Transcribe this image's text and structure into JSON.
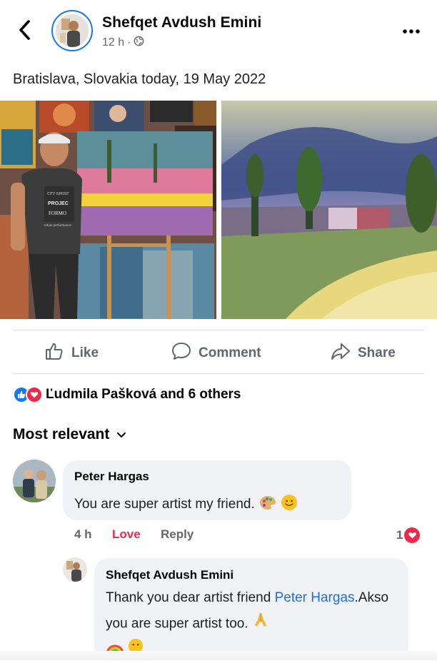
{
  "header": {
    "author": "Shefqet Avdush Emini",
    "time": "12 h",
    "dot": "·",
    "privacy_icon": "globe-icon"
  },
  "post": {
    "caption": "Bratislava, Slovakia today, 19 May 2022",
    "photo_left_shirt_lines": [
      "CITY GHOST",
      "PROJEC",
      "FORMO",
      "urban performance"
    ]
  },
  "actions": {
    "like": "Like",
    "comment": "Comment",
    "share": "Share"
  },
  "reactions": {
    "summary": "Ľudmila Pašková and 6 others",
    "icons": [
      "like-reaction-icon",
      "love-reaction-icon"
    ],
    "like_color": "#1877f2",
    "love_color": "#f02849"
  },
  "comments": {
    "sort_label": "Most relevant",
    "items": [
      {
        "name": "Peter Hargas",
        "text": "You are super artist my friend.",
        "emojis": [
          "palette-emoji",
          "smile-emoji"
        ],
        "time": "4 h",
        "love_action": "Love",
        "reply_action": "Reply",
        "reaction_count": "1"
      }
    ],
    "reply": {
      "name": "Shefqet Avdush Emini",
      "text_before": "Thank you dear artist friend ",
      "mention": "Peter Hargas",
      "text_after": ".Akso you are super artist too."
    }
  }
}
